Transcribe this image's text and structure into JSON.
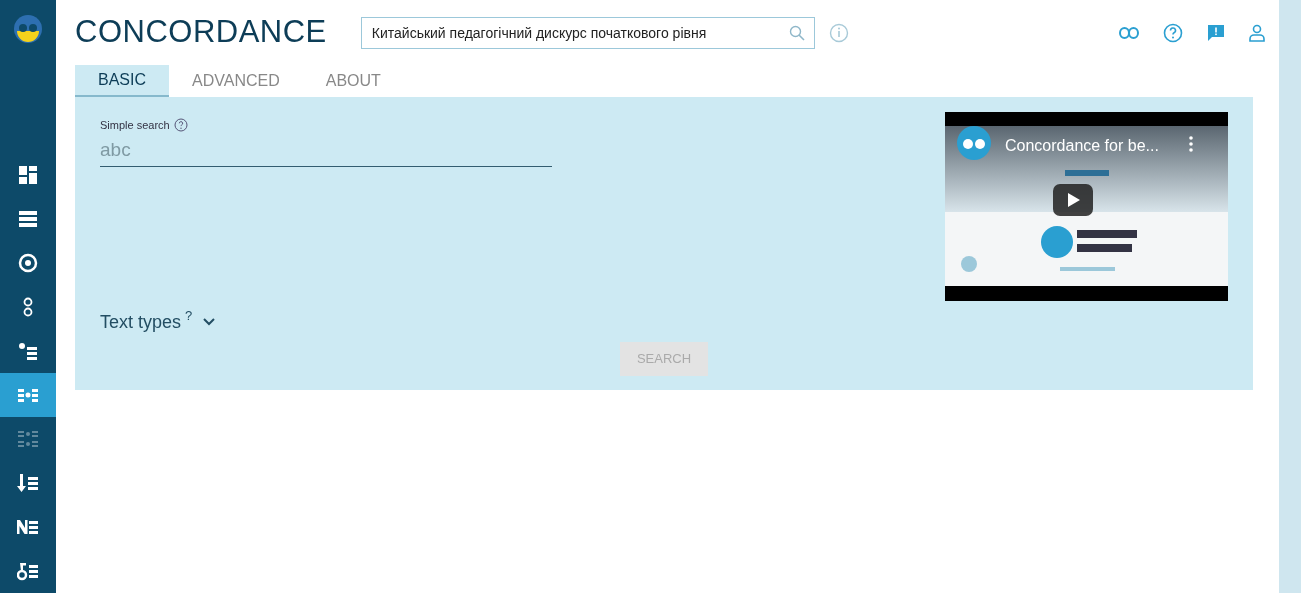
{
  "header": {
    "title": "CONCORDANCE",
    "corpus_field": {
      "value": "Китайський педагогічний дискурс початкового рівня"
    }
  },
  "sidebar": {
    "items": [
      {
        "kind": "dashboard",
        "selected": false,
        "disabled": false
      },
      {
        "kind": "list",
        "selected": false,
        "disabled": false
      },
      {
        "kind": "target",
        "selected": false,
        "disabled": false
      },
      {
        "kind": "rings",
        "selected": false,
        "disabled": false
      },
      {
        "kind": "dotlist",
        "selected": false,
        "disabled": false
      },
      {
        "kind": "concordance",
        "selected": true,
        "disabled": false
      },
      {
        "kind": "parallel",
        "selected": false,
        "disabled": true
      },
      {
        "kind": "arrowlist",
        "selected": false,
        "disabled": false
      },
      {
        "kind": "nlist",
        "selected": false,
        "disabled": false
      },
      {
        "kind": "keylist",
        "selected": false,
        "disabled": false
      }
    ]
  },
  "tabs": [
    {
      "label": "BASIC",
      "selected": true
    },
    {
      "label": "ADVANCED",
      "selected": false
    },
    {
      "label": "ABOUT",
      "selected": false
    }
  ],
  "form": {
    "simple_search": {
      "label": "Simple search",
      "placeholder": "abc"
    },
    "text_types": {
      "label": "Text types",
      "hint": "?",
      "expanded": false
    },
    "search_button": {
      "label": "SEARCH",
      "disabled": true
    }
  },
  "video": {
    "title": "Concordance for be..."
  }
}
